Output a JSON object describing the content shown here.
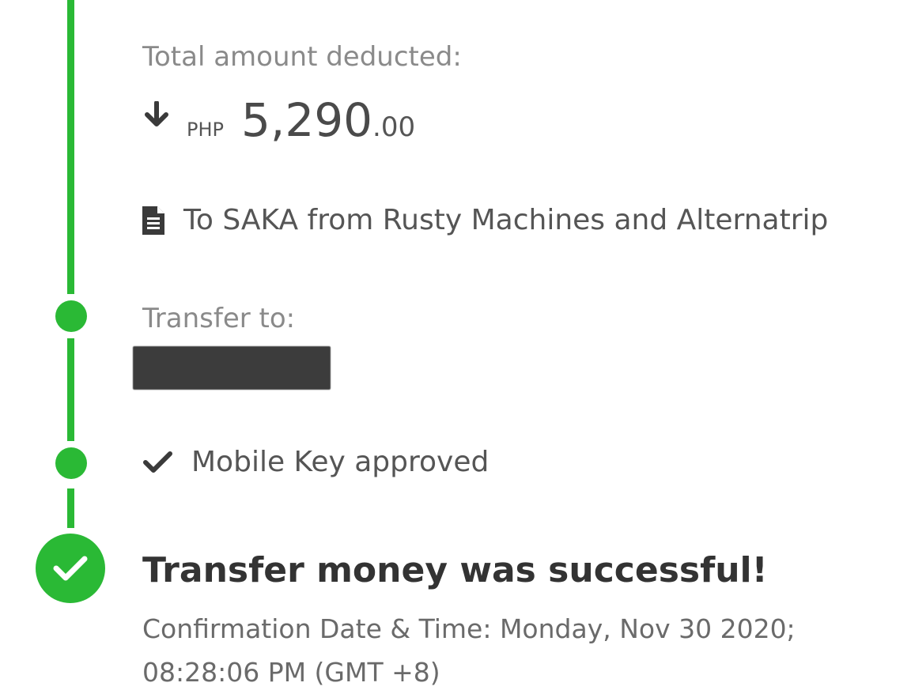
{
  "accent_color": "#2ab935",
  "summary": {
    "total_label": "Total amount deducted:",
    "currency": "PHP",
    "amount": "5,290",
    "cents": ".00",
    "note": "To SAKA from Rusty Machines and Alternatrip"
  },
  "transfer": {
    "label": "Transfer to:"
  },
  "approval": {
    "text": "Mobile Key approved"
  },
  "result": {
    "title": "Transfer money was successful!",
    "confirmation_line1": "Confirmation Date & Time: Monday, Nov 30 2020;",
    "confirmation_line2": "08:28:06 PM (GMT +8)"
  },
  "icons": [
    "down-arrow-icon",
    "document-icon",
    "check-icon",
    "success-check-icon"
  ]
}
